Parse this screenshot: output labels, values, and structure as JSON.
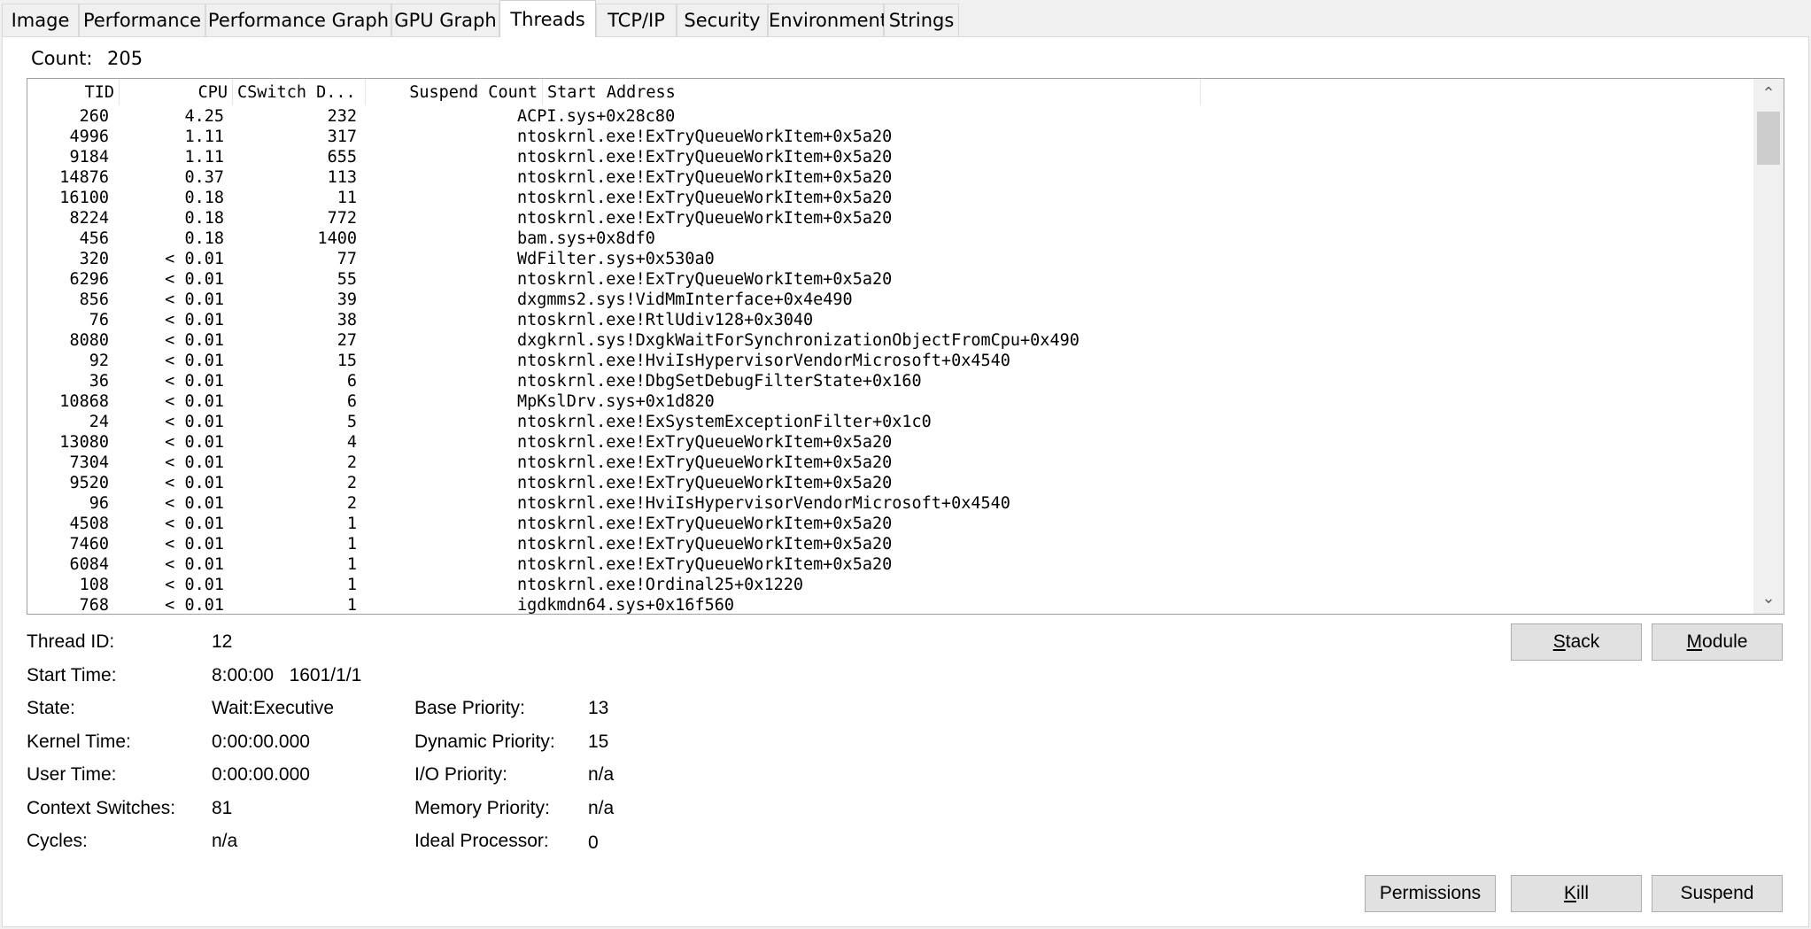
{
  "tabs": [
    {
      "label": "Image"
    },
    {
      "label": "Performance"
    },
    {
      "label": "Performance Graph"
    },
    {
      "label": "GPU Graph"
    },
    {
      "label": "Threads"
    },
    {
      "label": "TCP/IP"
    },
    {
      "label": "Security"
    },
    {
      "label": "Environment"
    },
    {
      "label": "Strings"
    }
  ],
  "active_tab": "Threads",
  "count": {
    "label": "Count:",
    "value": "205"
  },
  "columns": {
    "tid": "TID",
    "cpu": "CPU",
    "cswitch": "CSwitch D...",
    "suspend": "Suspend Count",
    "address": "Start Address"
  },
  "rows": [
    {
      "tid": "260",
      "cpu": "4.25",
      "cs": "232",
      "addr": "ACPI.sys+0x28c80"
    },
    {
      "tid": "4996",
      "cpu": "1.11",
      "cs": "317",
      "addr": "ntoskrnl.exe!ExTryQueueWorkItem+0x5a20"
    },
    {
      "tid": "9184",
      "cpu": "1.11",
      "cs": "655",
      "addr": "ntoskrnl.exe!ExTryQueueWorkItem+0x5a20"
    },
    {
      "tid": "14876",
      "cpu": "0.37",
      "cs": "113",
      "addr": "ntoskrnl.exe!ExTryQueueWorkItem+0x5a20"
    },
    {
      "tid": "16100",
      "cpu": "0.18",
      "cs": "11",
      "addr": "ntoskrnl.exe!ExTryQueueWorkItem+0x5a20"
    },
    {
      "tid": "8224",
      "cpu": "0.18",
      "cs": "772",
      "addr": "ntoskrnl.exe!ExTryQueueWorkItem+0x5a20"
    },
    {
      "tid": "456",
      "cpu": "0.18",
      "cs": "1400",
      "addr": "bam.sys+0x8df0"
    },
    {
      "tid": "320",
      "cpu": "< 0.01",
      "cs": "77",
      "addr": "WdFilter.sys+0x530a0"
    },
    {
      "tid": "6296",
      "cpu": "< 0.01",
      "cs": "55",
      "addr": "ntoskrnl.exe!ExTryQueueWorkItem+0x5a20"
    },
    {
      "tid": "856",
      "cpu": "< 0.01",
      "cs": "39",
      "addr": "dxgmms2.sys!VidMmInterface+0x4e490"
    },
    {
      "tid": "76",
      "cpu": "< 0.01",
      "cs": "38",
      "addr": "ntoskrnl.exe!RtlUdiv128+0x3040"
    },
    {
      "tid": "8080",
      "cpu": "< 0.01",
      "cs": "27",
      "addr": "dxgkrnl.sys!DxgkWaitForSynchronizationObjectFromCpu+0x490"
    },
    {
      "tid": "92",
      "cpu": "< 0.01",
      "cs": "15",
      "addr": "ntoskrnl.exe!HviIsHypervisorVendorMicrosoft+0x4540"
    },
    {
      "tid": "36",
      "cpu": "< 0.01",
      "cs": "6",
      "addr": "ntoskrnl.exe!DbgSetDebugFilterState+0x160"
    },
    {
      "tid": "10868",
      "cpu": "< 0.01",
      "cs": "6",
      "addr": "MpKslDrv.sys+0x1d820"
    },
    {
      "tid": "24",
      "cpu": "< 0.01",
      "cs": "5",
      "addr": "ntoskrnl.exe!ExSystemExceptionFilter+0x1c0"
    },
    {
      "tid": "13080",
      "cpu": "< 0.01",
      "cs": "4",
      "addr": "ntoskrnl.exe!ExTryQueueWorkItem+0x5a20"
    },
    {
      "tid": "7304",
      "cpu": "< 0.01",
      "cs": "2",
      "addr": "ntoskrnl.exe!ExTryQueueWorkItem+0x5a20"
    },
    {
      "tid": "9520",
      "cpu": "< 0.01",
      "cs": "2",
      "addr": "ntoskrnl.exe!ExTryQueueWorkItem+0x5a20"
    },
    {
      "tid": "96",
      "cpu": "< 0.01",
      "cs": "2",
      "addr": "ntoskrnl.exe!HviIsHypervisorVendorMicrosoft+0x4540"
    },
    {
      "tid": "4508",
      "cpu": "< 0.01",
      "cs": "1",
      "addr": "ntoskrnl.exe!ExTryQueueWorkItem+0x5a20"
    },
    {
      "tid": "7460",
      "cpu": "< 0.01",
      "cs": "1",
      "addr": "ntoskrnl.exe!ExTryQueueWorkItem+0x5a20"
    },
    {
      "tid": "6084",
      "cpu": "< 0.01",
      "cs": "1",
      "addr": "ntoskrnl.exe!ExTryQueueWorkItem+0x5a20"
    },
    {
      "tid": "108",
      "cpu": "< 0.01",
      "cs": "1",
      "addr": "ntoskrnl.exe!Ordinal25+0x1220"
    },
    {
      "tid": "768",
      "cpu": "< 0.01",
      "cs": "1",
      "addr": "igdkmdn64.sys+0x16f560"
    }
  ],
  "details": {
    "thread_id": {
      "label": "Thread ID:",
      "value": "12"
    },
    "start_time": {
      "label": "Start Time:",
      "value": "8:00:00   1601/1/1"
    },
    "state": {
      "label": "State:",
      "value": "Wait:Executive"
    },
    "kernel_time": {
      "label": "Kernel Time:",
      "value": "0:00:00.000"
    },
    "user_time": {
      "label": "User Time:",
      "value": "0:00:00.000"
    },
    "context_switches": {
      "label": "Context Switches:",
      "value": "81"
    },
    "cycles": {
      "label": "Cycles:",
      "value": "n/a"
    },
    "base_priority": {
      "label": "Base Priority:",
      "value": "13"
    },
    "dynamic_priority": {
      "label": "Dynamic Priority:",
      "value": "15"
    },
    "io_priority": {
      "label": "I/O Priority:",
      "value": "n/a"
    },
    "memory_priority": {
      "label": "Memory Priority:",
      "value": "n/a"
    },
    "ideal_processor": {
      "label": "Ideal Processor:",
      "value": "0"
    }
  },
  "buttons": {
    "stack": {
      "first": "S",
      "rest": "tack"
    },
    "module": {
      "first": "M",
      "rest": "odule"
    },
    "permissions": "Permissions",
    "kill": {
      "first": "K",
      "rest": "ill"
    },
    "suspend": "Suspend"
  },
  "icons": {
    "sort": "chevron-down-icon",
    "scroll_up": "chevron-up-icon",
    "scroll_down": "chevron-down-icon"
  }
}
